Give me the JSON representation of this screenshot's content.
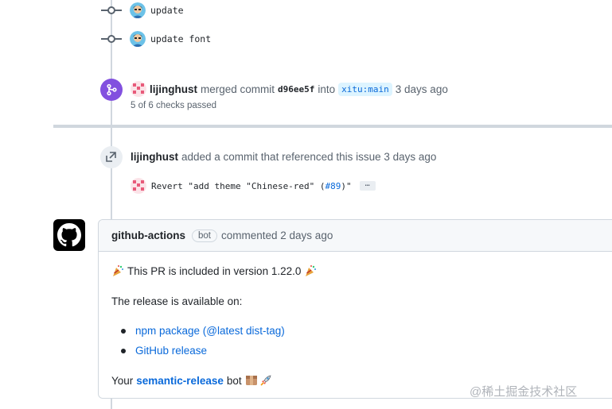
{
  "commits": [
    {
      "message": "update"
    },
    {
      "message": "update font"
    }
  ],
  "merge_event": {
    "author": "lijinghust",
    "action_pre": "merged commit",
    "sha": "d96ee5f",
    "into": "into",
    "branch": "xitu:main",
    "time": "3 days ago",
    "checks": "5 of 6 checks passed"
  },
  "reference_event": {
    "author": "lijinghust",
    "action": "added a commit that referenced this issue 3 days ago",
    "commit_prefix": "Revert \"add theme \"Chinese-red\" (",
    "commit_link": "#89",
    "commit_suffix": ")\"",
    "ellipsis": "…"
  },
  "comment": {
    "author": "github-actions",
    "bot_label": "bot",
    "action": "commented 2 days ago",
    "line1": "This PR is included in version 1.22.0",
    "line2": "The release is available on:",
    "list": [
      {
        "label": "npm package (@latest dist-tag)"
      },
      {
        "label": "GitHub release"
      }
    ],
    "footer_pre": "Your",
    "footer_link": "semantic-release",
    "footer_post": "bot"
  },
  "watermark": "@稀土掘金技术社区",
  "colors": {
    "merged": "#8250df",
    "link": "#0969da",
    "border": "#d0d7de"
  }
}
